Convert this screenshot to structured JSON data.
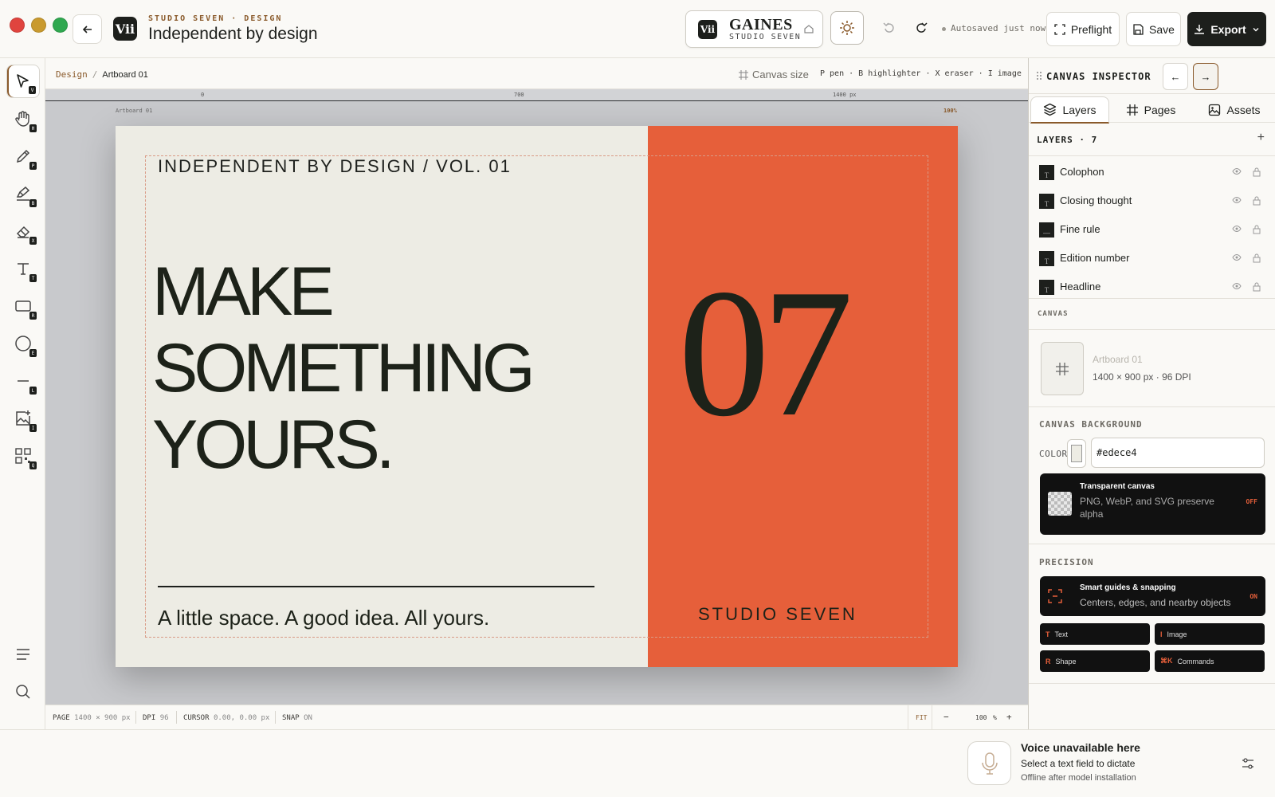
{
  "header": {
    "eyebrow": "STUDIO SEVEN · DESIGN",
    "title": "Independent by design",
    "app_logo": "Vii",
    "brand": {
      "mark": "Vii",
      "name": "GAINES",
      "sub": "STUDIO SEVEN"
    },
    "autosave": "Autosaved just now",
    "preflight_label": "Preflight",
    "save_label": "Save",
    "export_label": "Export"
  },
  "tools": {
    "select_key": "V",
    "hand_key": "H",
    "pen_key": "P",
    "highlighter_key": "B",
    "eraser_key": "X",
    "text_key": "T",
    "rect_key": "R",
    "ellipse_key": "E",
    "line_key": "L",
    "image_key": "I",
    "qr_key": "Q"
  },
  "canvas": {
    "breadcrumb": {
      "root": "Design",
      "sep": "/",
      "current": "Artboard 01"
    },
    "canvas_size_label": "Canvas size",
    "shortcuts": "P pen · B highlighter · X eraser · I image",
    "ruler": {
      "t0": "0",
      "t1": "700",
      "t2": "1400 px"
    },
    "artboard_label": "Artboard 01",
    "zoom_tag": "100%"
  },
  "artboard": {
    "volume": "INDEPENDENT BY DESIGN / VOL. 01",
    "headline": [
      "MAKE",
      "SOMETHING",
      "YOURS."
    ],
    "number": "07",
    "closing": "A little space. A good idea. All yours.",
    "studio": "STUDIO SEVEN",
    "background": "#edece4",
    "accent": "#e65f3a"
  },
  "statusbar": {
    "page_label": "PAGE",
    "page_value": "1400 × 900 px",
    "dpi_label": "DPI",
    "dpi_value": "96",
    "cursor_label": "CURSOR",
    "cursor_value": "0.00, 0.00 px",
    "snap_label": "SNAP",
    "snap_value": "ON",
    "fit": "FIT",
    "zoom": "100",
    "zoom_unit": "%"
  },
  "inspector": {
    "title": "CANVAS INSPECTOR",
    "tabs": [
      "Layers",
      "Pages",
      "Assets"
    ],
    "layers_title": "LAYERS · 7",
    "layers": [
      {
        "name": "Colophon",
        "type": "T"
      },
      {
        "name": "Closing thought",
        "type": "T"
      },
      {
        "name": "Fine rule",
        "type": "—"
      },
      {
        "name": "Edition number",
        "type": "T"
      },
      {
        "name": "Headline",
        "type": "T"
      }
    ],
    "canvas_section": "CANVAS",
    "canvas_name": "Artboard 01",
    "canvas_dims": "1400 × 900 px · 96 DPI",
    "bg_section": "CANVAS BACKGROUND",
    "color_label": "COLOR",
    "color_value": "#edece4",
    "transparent": {
      "title": "Transparent canvas",
      "sub": "PNG, WebP, and SVG preserve alpha",
      "flag": "OFF"
    },
    "precision_section": "PRECISION",
    "snapping": {
      "title": "Smart guides & snapping",
      "sub": "Centers, edges, and nearby objects",
      "flag": "ON"
    },
    "chips": [
      {
        "key": "T",
        "label": "Text"
      },
      {
        "key": "I",
        "label": "Image"
      },
      {
        "key": "R",
        "label": "Shape"
      },
      {
        "key": "⌘K",
        "label": "Commands"
      }
    ]
  },
  "voice": {
    "title": "Voice unavailable here",
    "sub": "Select a text field to dictate",
    "note": "Offline after model installation"
  }
}
